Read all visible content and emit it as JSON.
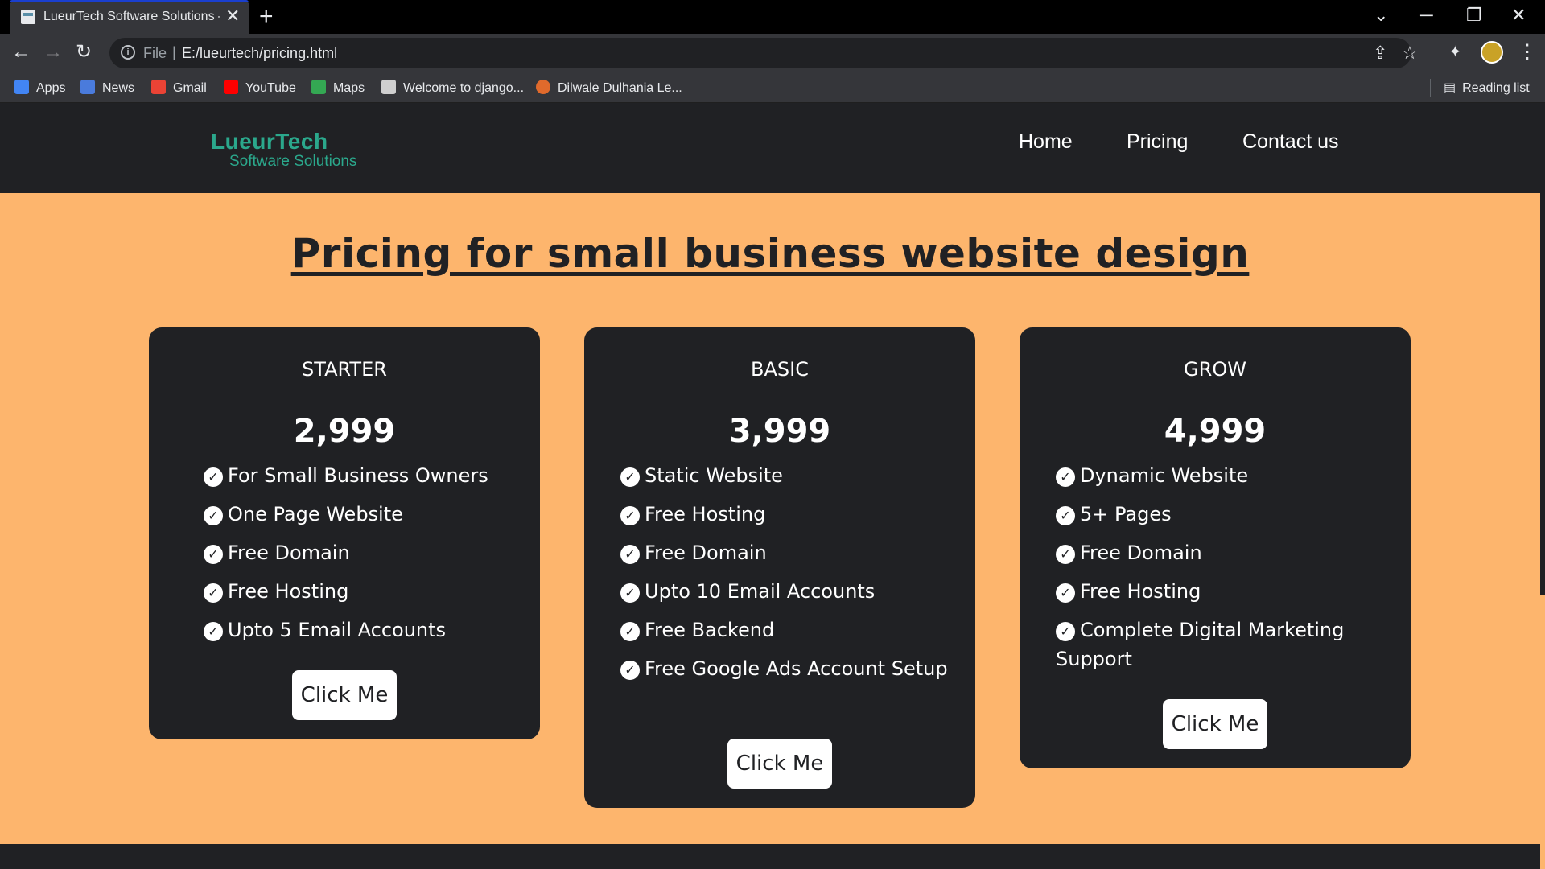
{
  "browser": {
    "tab_title": "LueurTech Software Solutions – I",
    "url_scheme_label": "File",
    "url": "E:/lueurtech/pricing.html",
    "bookmarks": [
      {
        "label": "Apps",
        "icon": "apps-grid-icon",
        "color": "#4285f4"
      },
      {
        "label": "News",
        "icon": "news-icon",
        "color": "#4a7bdc"
      },
      {
        "label": "Gmail",
        "icon": "gmail-icon",
        "color": "#ea4335"
      },
      {
        "label": "YouTube",
        "icon": "youtube-icon",
        "color": "#ff0000"
      },
      {
        "label": "Maps",
        "icon": "maps-icon",
        "color": "#34a853"
      },
      {
        "label": "Welcome to django...",
        "icon": "django-icon",
        "color": "#cfcfcf"
      },
      {
        "label": "Dilwale Dulhania Le...",
        "icon": "movie-icon",
        "color": "#e06a2c"
      }
    ],
    "reading_list": "Reading list"
  },
  "site": {
    "logo_main": "LueurTech",
    "logo_sub": "Software Solutions",
    "nav": [
      "Home",
      "Pricing",
      "Contact us"
    ],
    "heading": "Pricing for small business website design"
  },
  "plans": [
    {
      "name": "STARTER",
      "price": "2,999",
      "features": [
        "For Small Business Owners",
        "One Page Website",
        "Free Domain",
        "Free Hosting",
        "Upto 5 Email Accounts"
      ],
      "cta": "Click Me"
    },
    {
      "name": "BASIC",
      "price": "3,999",
      "features": [
        "Static Website",
        "Free Hosting",
        "Free Domain",
        "Upto 10 Email Accounts",
        "Free Backend",
        "Free Google Ads Account Setup"
      ],
      "cta": "Click Me"
    },
    {
      "name": "GROW",
      "price": "4,999",
      "features": [
        "Dynamic Website",
        "5+ Pages",
        "Free Domain",
        "Free Hosting",
        "Complete Digital Marketing Support"
      ],
      "cta": "Click Me"
    }
  ],
  "colors": {
    "page_bg": "#fdb56d",
    "card_bg": "#202124",
    "logo": "#2ba88c"
  }
}
